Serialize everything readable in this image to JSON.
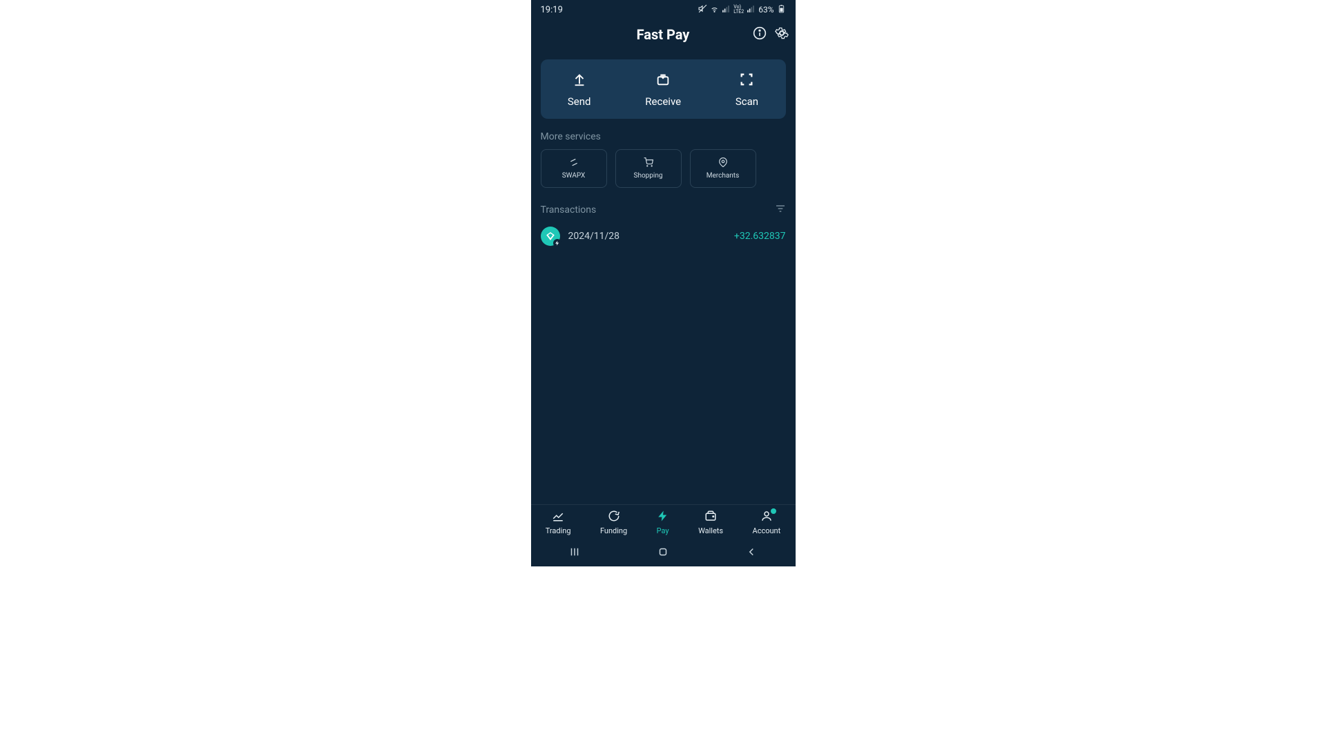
{
  "status": {
    "time": "19:19",
    "battery": "63%",
    "lte_label": "LTE2",
    "vo_label": "Vo)"
  },
  "header": {
    "title": "Fast Pay"
  },
  "actions": {
    "send": "Send",
    "receive": "Receive",
    "scan": "Scan"
  },
  "more_services": {
    "label": "More services",
    "items": [
      {
        "label": "SWAPX"
      },
      {
        "label": "Shopping"
      },
      {
        "label": "Merchants"
      }
    ]
  },
  "transactions": {
    "label": "Transactions",
    "rows": [
      {
        "date": "2024/11/28",
        "amount": "+32.632837"
      }
    ]
  },
  "bottom_nav": {
    "trading": "Trading",
    "funding": "Funding",
    "pay": "Pay",
    "wallets": "Wallets",
    "account": "Account"
  },
  "colors": {
    "accent": "#1fc7b6",
    "bg": "#0e2438",
    "panel": "#1a3a56"
  }
}
